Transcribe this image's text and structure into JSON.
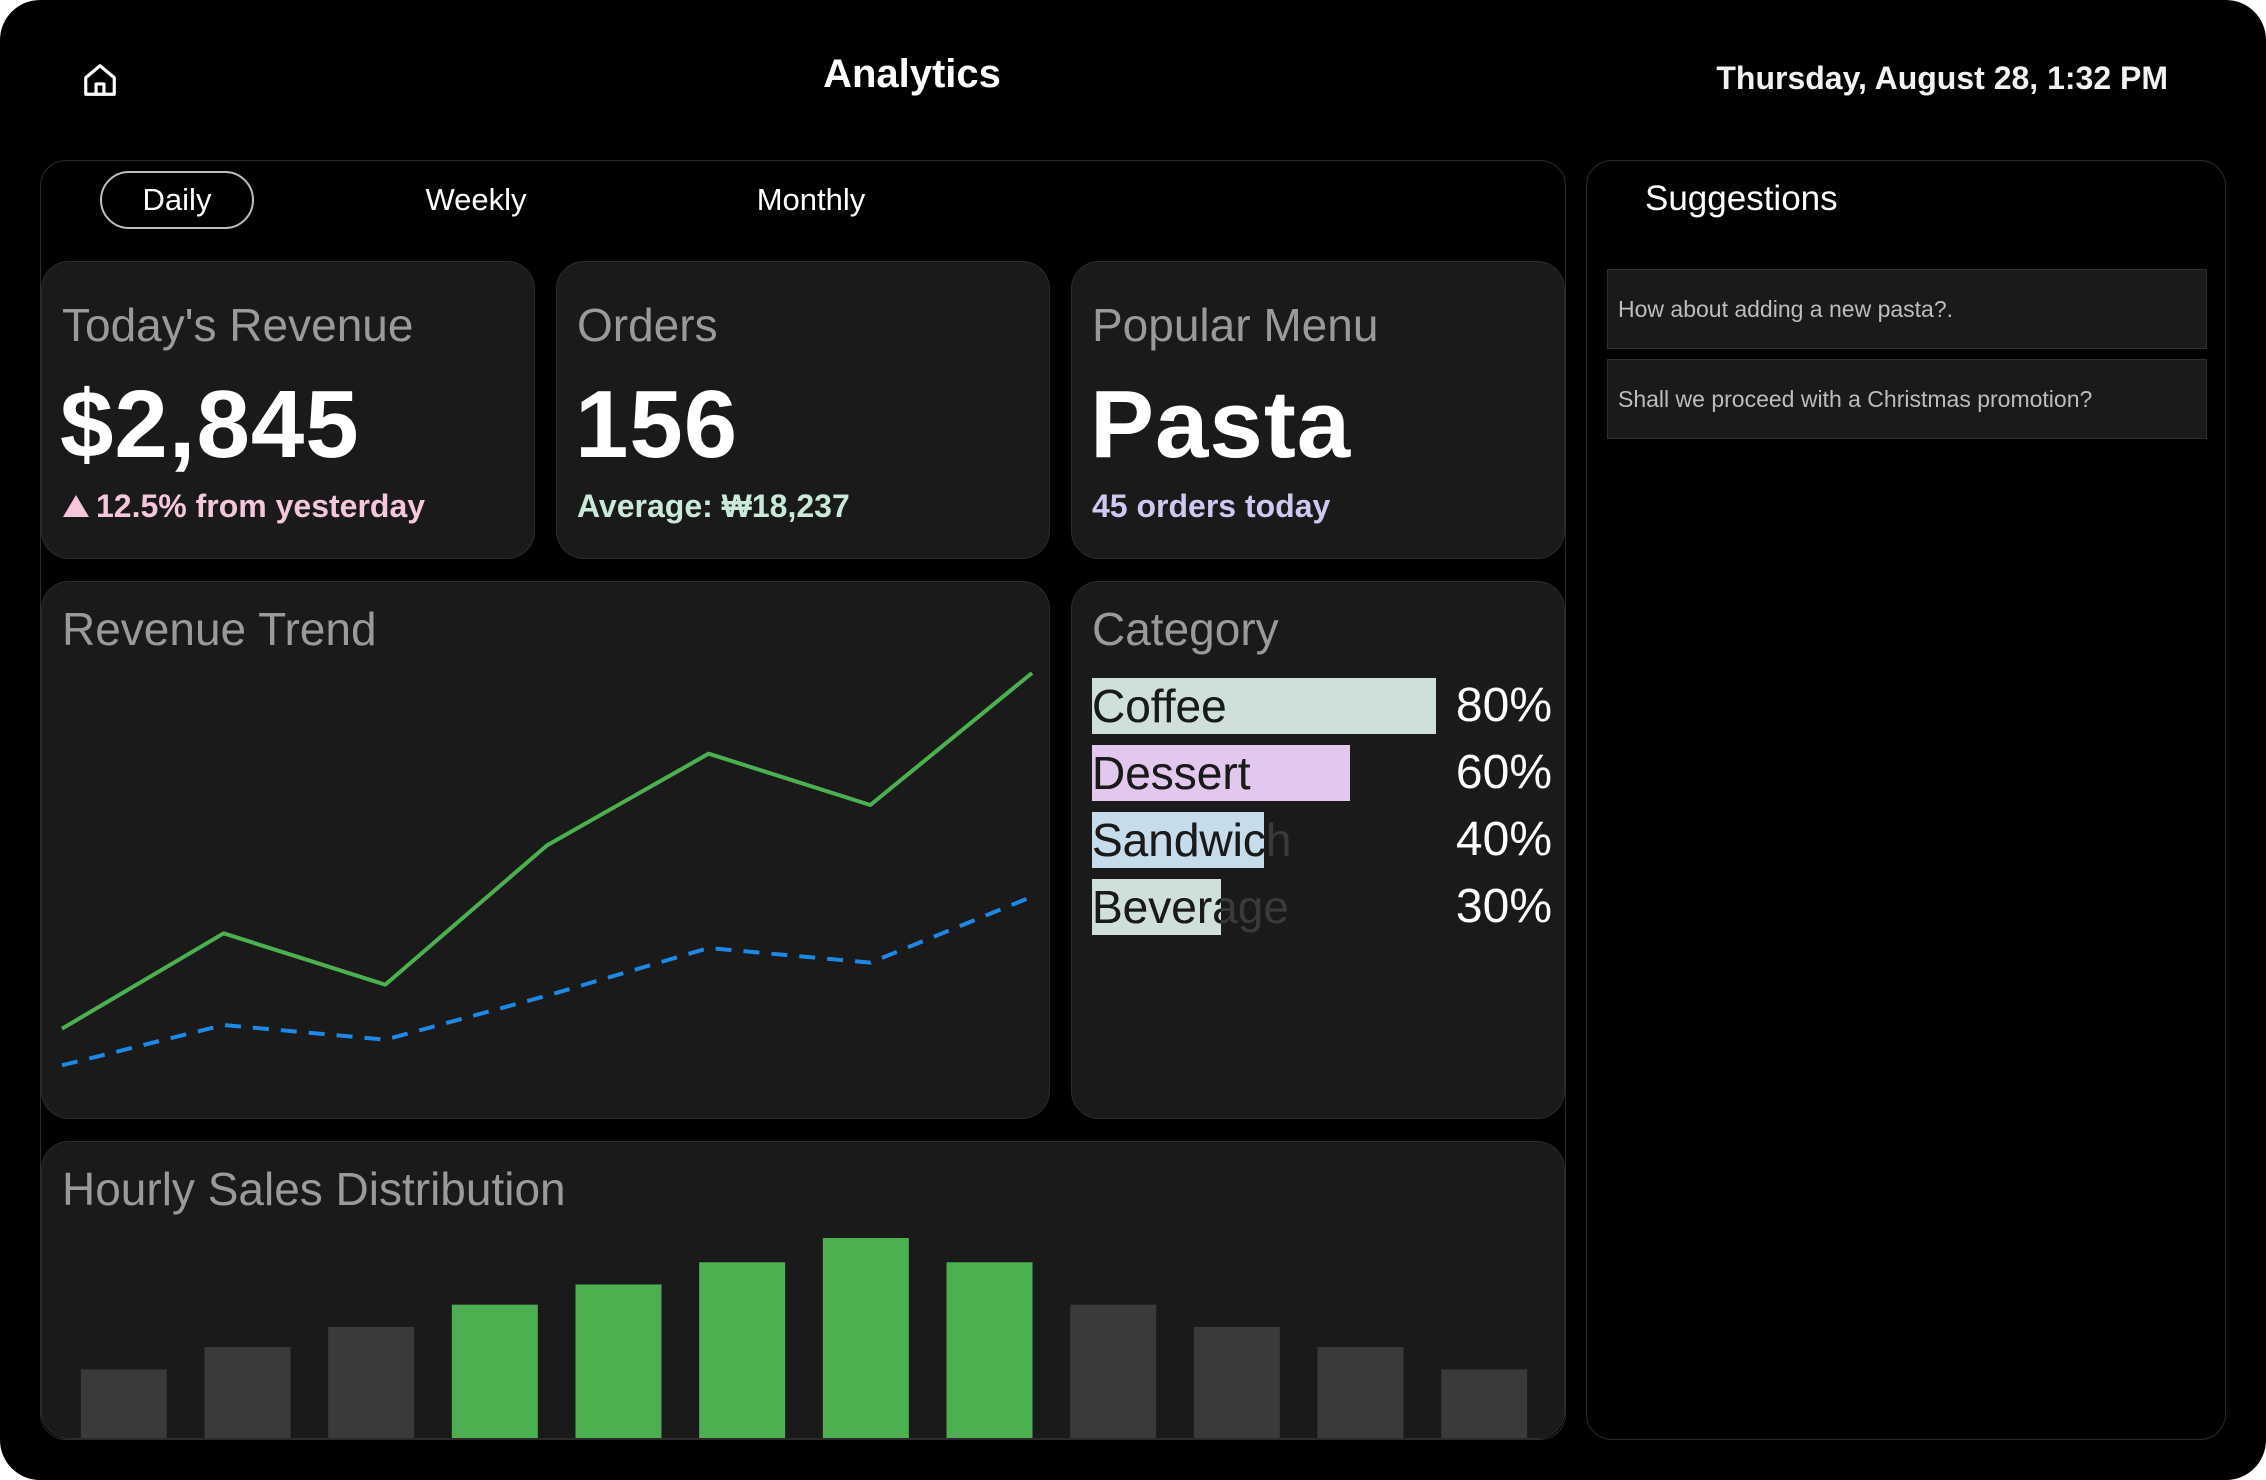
{
  "header": {
    "home_icon": "home-icon",
    "title": "Analytics",
    "datetime": "Thursday, August 28, 1:32 PM"
  },
  "tabs": [
    {
      "label": "Daily",
      "selected": true
    },
    {
      "label": "Weekly",
      "selected": false
    },
    {
      "label": "Monthly",
      "selected": false
    }
  ],
  "revenue": {
    "title": "Today's Revenue",
    "value": "$2,845",
    "change_icon": "triangle-up-icon",
    "change": "12.5% from yesterday",
    "change_color": "#f5c6dc"
  },
  "orders": {
    "title": "Orders",
    "value": "156",
    "average": "Average: ₩18,237",
    "average_color": "#c9ead8"
  },
  "popular": {
    "title": "Popular Menu",
    "value": "Pasta",
    "sub": "45 orders today",
    "sub_color": "#cfc8f2"
  },
  "trend": {
    "title": "Revenue Trend"
  },
  "category": {
    "title": "Category",
    "items": [
      {
        "label": "Coffee",
        "percent": "80%",
        "value": 80,
        "color": "#cfe0dc"
      },
      {
        "label": "Dessert",
        "percent": "60%",
        "value": 60,
        "color": "#e2c8ee"
      },
      {
        "label": "Sandwich",
        "percent": "40%",
        "value": 40,
        "color": "#c7dcea"
      },
      {
        "label": "Beverage",
        "percent": "30%",
        "value": 30,
        "color": "#cfe0dc"
      }
    ]
  },
  "hourly": {
    "title": "Hourly Sales Distribution"
  },
  "suggestions": {
    "title": "Suggestions",
    "items": [
      "How about adding a new pasta?.",
      "Shall we proceed with a Christmas promotion?"
    ]
  },
  "chart_data": [
    {
      "type": "line",
      "x": [
        1,
        2,
        3,
        4,
        5,
        6,
        7
      ],
      "series": [
        {
          "values": [
            20,
            46,
            32,
            70,
            95,
            81,
            117
          ],
          "color": "#4caf50",
          "style": "solid"
        },
        {
          "values": [
            10,
            21,
            17,
            29,
            42,
            38,
            56
          ],
          "color": "#1e88e5",
          "style": "dashed"
        }
      ],
      "ylim": [
        0,
        120
      ],
      "grid": false
    },
    {
      "type": "bar",
      "values": [
        35,
        46,
        56,
        67,
        77,
        88,
        100,
        88,
        67,
        56,
        46,
        35
      ],
      "highlight": [
        false,
        false,
        false,
        true,
        true,
        true,
        true,
        true,
        false,
        false,
        false,
        false
      ],
      "colors": {
        "normal": "#3a3a3a",
        "highlight": "#4caf50"
      },
      "ylim": [
        0,
        100
      ],
      "grid": false
    }
  ]
}
